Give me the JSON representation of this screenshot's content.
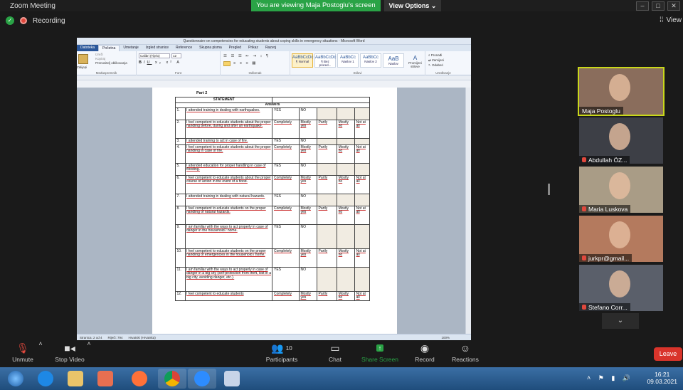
{
  "zoom": {
    "title": "Zoom Meeting",
    "share_banner": "You are viewing Maja Postoglu's screen",
    "view_options": "View Options",
    "recording": "Recording",
    "view": "View"
  },
  "word": {
    "title": "Questionnaire on competencies for educating students about coping skills in emergency situations - Microsoft Word",
    "tabs": [
      "Datoteka",
      "Početna",
      "Umetanje",
      "Izgled stranice",
      "Reference",
      "Skupna pisma",
      "Pregled",
      "Prikaz",
      "Razvoj"
    ],
    "ribbon": {
      "paste": "Zalijepi",
      "cut": "Izreži",
      "copy": "Kopiraj",
      "format_painter": "Prenositelj oblikovanja",
      "font": "Calibri (Tijelo)",
      "size": "12",
      "group_clipboard": "Međuspremnik",
      "group_font": "Font",
      "group_paragraph": "Odlomak",
      "group_styles": "Stilovi",
      "group_editing": "Uređivanje",
      "styles": [
        {
          "sample": "AaBbCcDc",
          "name": "¶ Normal"
        },
        {
          "sample": "AaBbCcDc",
          "name": "¶ Bez prored..."
        },
        {
          "sample": "AaBbCc",
          "name": "Naslov 1"
        },
        {
          "sample": "AaBbCc",
          "name": "Naslov 2"
        },
        {
          "sample": "AaB",
          "name": "Naslov"
        }
      ],
      "change_styles": "Promijeni stilove",
      "find": "Pronađi",
      "replace": "Zamijeni",
      "select": "Odaberi"
    },
    "status": {
      "page": "Stranica: 2 od 4",
      "words": "Riječi: 794",
      "lang": "Hrvatski (Hrvatska)",
      "zoom": "100%"
    }
  },
  "document": {
    "part": "Part 2",
    "statement_header": "STATEMENT",
    "answers_header": "Answers",
    "rows": [
      {
        "n": "1.",
        "s": "I attended training in dealing with earthquakes.",
        "a": [
          "YES",
          "NO"
        ]
      },
      {
        "n": "2.",
        "s": "I feel competent to educate students about the proper handling before, during and after an earthquake.",
        "a": [
          "Completely",
          "Mostly yes",
          "Partly",
          "Mostly no",
          "Not at all"
        ]
      },
      {
        "n": "3.",
        "s": "I attended training to act in case of fire.",
        "a": [
          "YES",
          "NO"
        ]
      },
      {
        "n": "4.",
        "s": "I feel competent to educate students about the proper handling in case of fire.",
        "a": [
          "Completely",
          "Mostly yes",
          "Partly",
          "Mostly no",
          "Not at all"
        ]
      },
      {
        "n": "5.",
        "s": "I attended education for proper handling in case of flooding.",
        "a": [
          "YES",
          "NO"
        ]
      },
      {
        "n": "6.",
        "s": "I feel competent to educate students about the proper course of action in the event of a flood.",
        "a": [
          "Completely",
          "Mostly yes",
          "Partly",
          "Mostly no",
          "Not at all"
        ]
      },
      {
        "n": "7.",
        "s": "I attended training in dealing with natural hazards.",
        "a": [
          "YES",
          "NO"
        ]
      },
      {
        "n": "8.",
        "s": "I feel competent to educate students on the proper handling of natural hazards.",
        "a": [
          "Completely",
          "Mostly yes",
          "Partly",
          "Mostly no",
          "Not at all"
        ]
      },
      {
        "n": "9.",
        "s": "I am familiar with the ways to act properly in case of danger in the household / home.",
        "a": [
          "YES",
          "NO"
        ]
      },
      {
        "n": "10.",
        "s": "I feel competent to educate students on the proper handling of emergencies in the household / home.",
        "a": [
          "Completely",
          "Mostly yes",
          "Partly",
          "Mostly no",
          "Not at all"
        ]
      },
      {
        "n": "11.",
        "s": "I am familiar with the ways to act properly in case of danger in a big city (self-protection from theft, lost in a big city, avoiding danger, etc.).",
        "a": [
          "YES",
          "NO"
        ]
      },
      {
        "n": "12.",
        "s": "I feel competent to educate students",
        "a": [
          "Completely",
          "Mostly yes",
          "Partly",
          "Mostly no",
          "Not at all"
        ]
      }
    ]
  },
  "participants": [
    {
      "name": "Maja Postoglu",
      "muted": false,
      "bg": "#8a6d5c"
    },
    {
      "name": "Abdullah ÖZ...",
      "muted": true,
      "bg": "#3d3f46"
    },
    {
      "name": "Maria Luskova",
      "muted": true,
      "bg": "#a99c86"
    },
    {
      "name": "jurkpr@gmail...",
      "muted": true,
      "bg": "#b47a5e"
    },
    {
      "name": "Stefano Corr...",
      "muted": true,
      "bg": "#5a5f6a"
    }
  ],
  "toolbar": {
    "unmute": "Unmute",
    "stop_video": "Stop Video",
    "participants": "Participants",
    "participants_count": "10",
    "chat": "Chat",
    "share_screen": "Share Screen",
    "record": "Record",
    "reactions": "Reactions",
    "leave": "Leave"
  },
  "taskbar": {
    "time": "16:21",
    "date": "09.03.2021"
  }
}
